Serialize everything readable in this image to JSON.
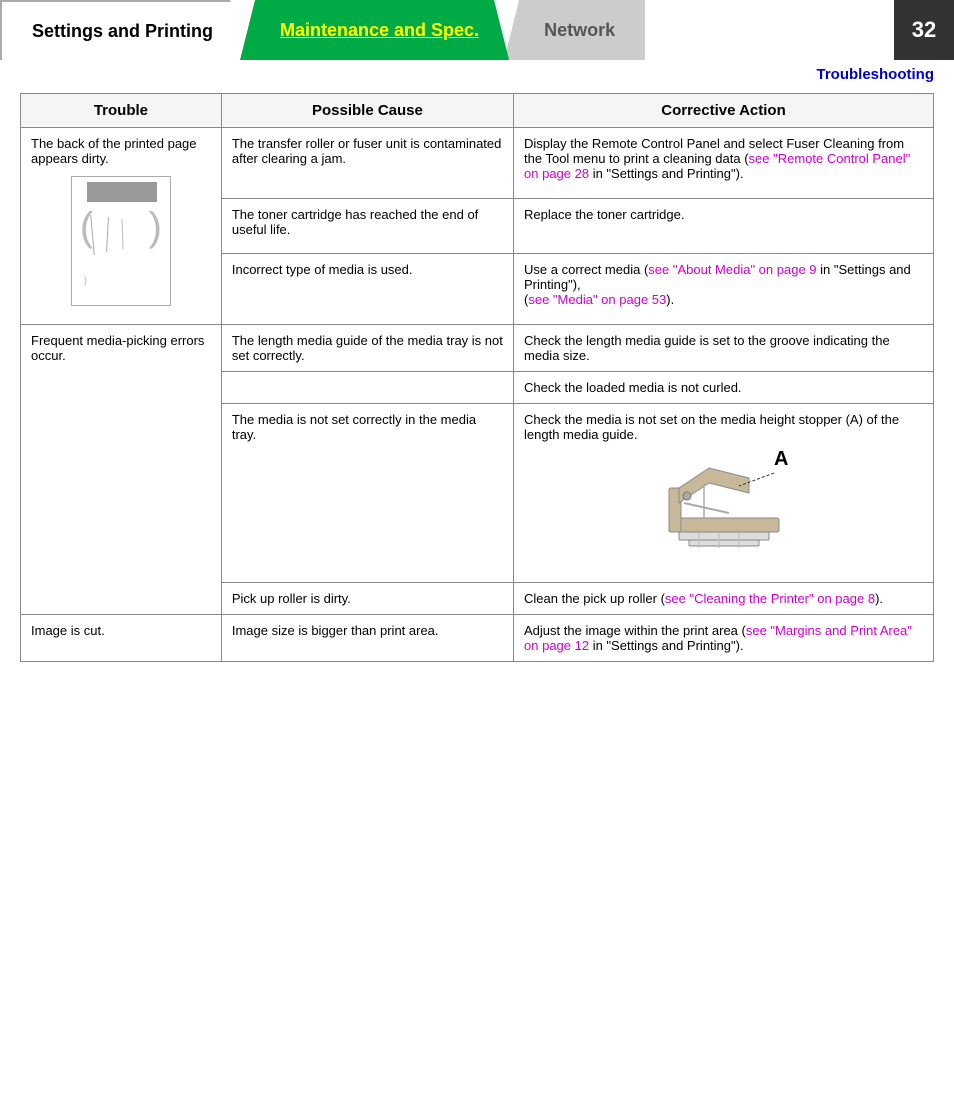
{
  "header": {
    "tab_settings": "Settings and Printing",
    "tab_maintenance": "Maintenance and Spec.",
    "tab_network": "Network",
    "page_number": "32",
    "troubleshooting_label": "Troubleshooting"
  },
  "table": {
    "col_trouble": "Trouble",
    "col_cause": "Possible Cause",
    "col_action": "Corrective Action",
    "rows": [
      {
        "trouble": "The back of the printed page appears dirty.",
        "causes": [
          {
            "cause": "The transfer roller or fuser unit is contaminated after clearing a jam.",
            "action": "Display the Remote Control Panel and select Fuser Cleaning from the Tool menu to print a cleaning data (",
            "link": "see \"Remote Control Panel\" on page 28",
            "action_after": " in \"Settings and Printing\")."
          },
          {
            "cause": "The toner cartridge has reached the end of useful life.",
            "action": "Replace the toner cartridge.",
            "link": "",
            "action_after": ""
          },
          {
            "cause": "Incorrect type of media is used.",
            "action": "Use a correct media (",
            "link": "see \"About Media\" on page 9",
            "action_mid": " in \"Settings and Printing\"),\n(",
            "link2": "see \"Media\" on page 53",
            "action_after": ")."
          }
        ]
      },
      {
        "trouble": "Frequent media-picking errors occur.",
        "causes": [
          {
            "cause": "The length media guide of the media tray is not set correctly.",
            "action": "Check the length media guide is set to the groove indicating the media size.",
            "link": "",
            "action_after": ""
          },
          {
            "cause": "",
            "action": "Check the loaded media is not curled.",
            "link": "",
            "action_after": ""
          },
          {
            "cause": "The media is not set correctly in the media tray.",
            "action": "Check the media is not set on the media height stopper (A) of the length media guide.",
            "link": "",
            "action_after": "",
            "has_image": true
          },
          {
            "cause": "Pick up roller is dirty.",
            "action": "Clean the pick up roller (",
            "link": "see \"Cleaning the Printer\" on page 8",
            "action_after": ")."
          }
        ]
      },
      {
        "trouble": "Image is cut.",
        "causes": [
          {
            "cause": "Image size is bigger than print area.",
            "action": "Adjust the image within the print area (",
            "link": "see \"Margins and Print Area\" on page 12",
            "action_after": " in \"Settings and Printing\")."
          }
        ]
      }
    ]
  }
}
